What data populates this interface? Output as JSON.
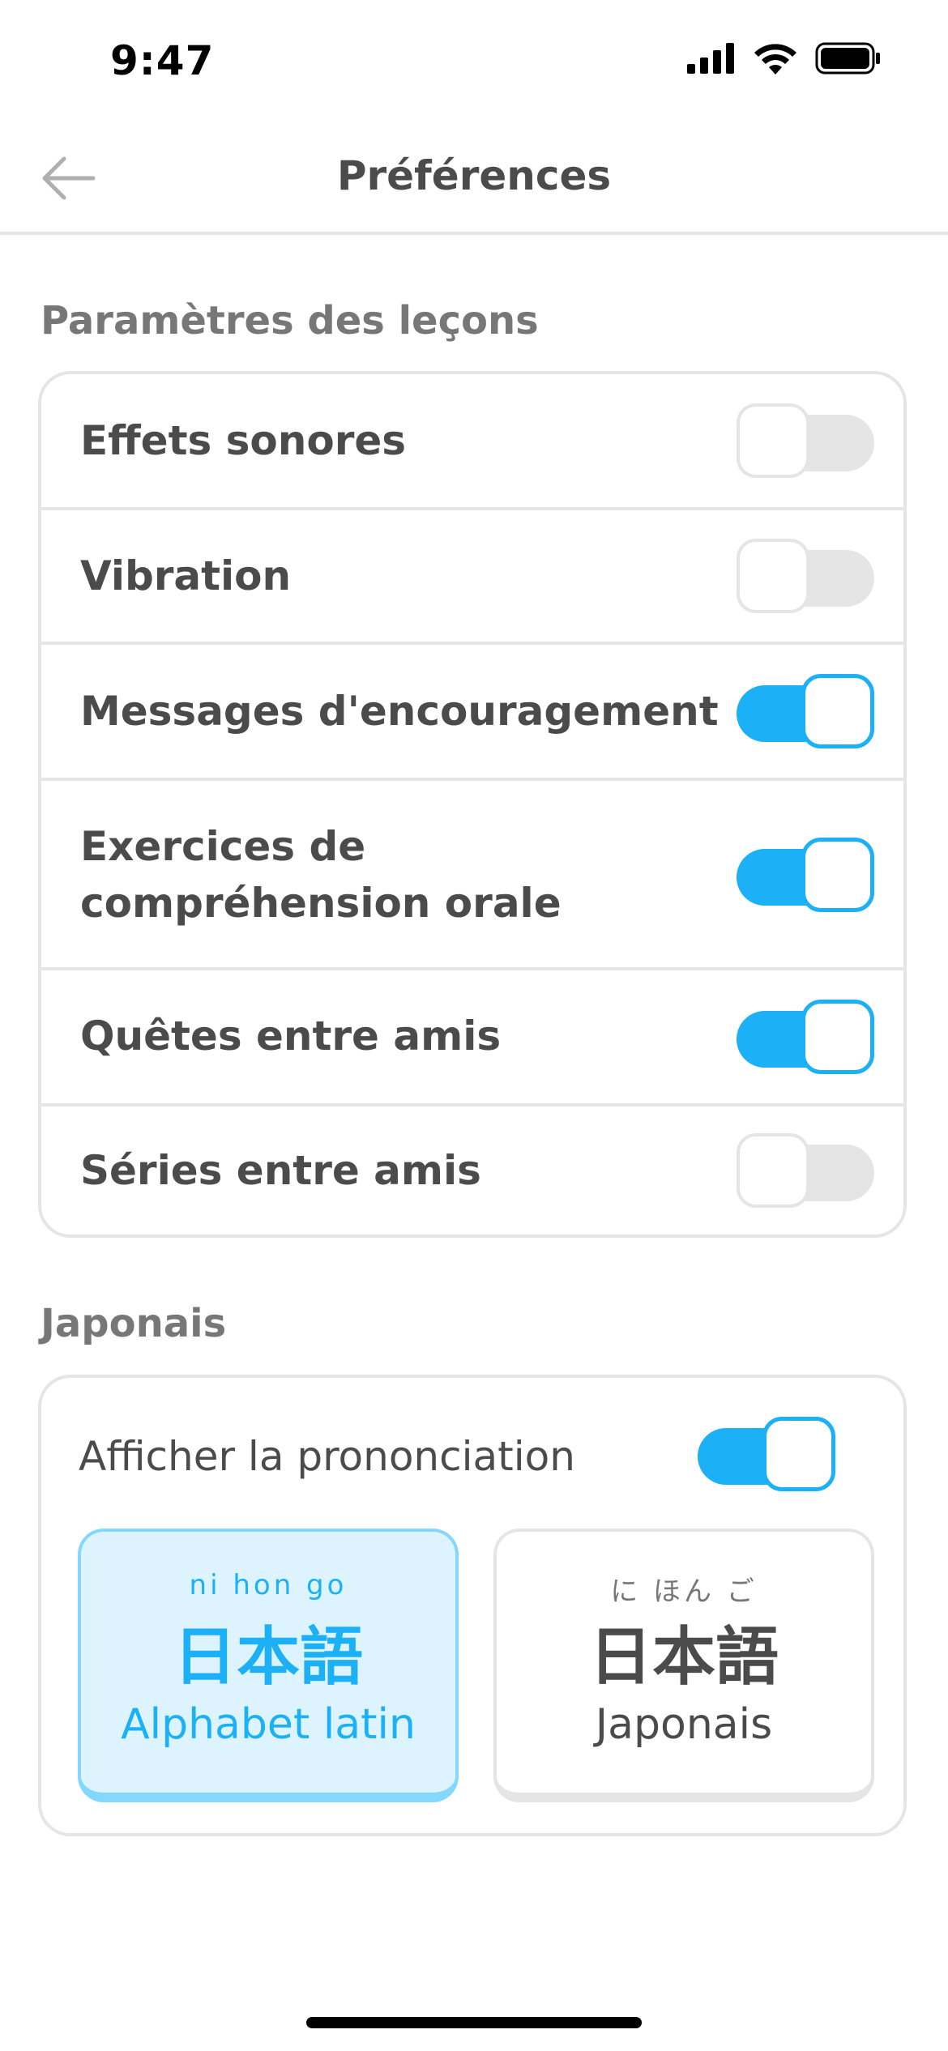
{
  "status_bar": {
    "time": "9:47"
  },
  "header": {
    "title": "Préférences"
  },
  "lesson_settings": {
    "title": "Paramètres des leçons",
    "items": [
      {
        "label": "Effets sonores",
        "enabled": false
      },
      {
        "label": "Vibration",
        "enabled": false
      },
      {
        "label": "Messages d'encouragement",
        "enabled": true
      },
      {
        "label_line1": "Exercices de",
        "label_line2": "compréhension orale",
        "enabled": true
      },
      {
        "label": "Quêtes entre amis",
        "enabled": true
      },
      {
        "label": "Séries entre amis",
        "enabled": false
      }
    ]
  },
  "japanese": {
    "title": "Japonais",
    "show_pronunciation_label": "Afficher la prononciation",
    "show_pronunciation_enabled": true,
    "options": [
      {
        "furigana": "ni hon go",
        "kanji": "日本語",
        "label": "Alphabet latin",
        "selected": true
      },
      {
        "furigana": "に ほん ご",
        "kanji": "日本語",
        "label": "Japonais",
        "selected": false
      }
    ]
  },
  "colors": {
    "accent": "#1cb0f6",
    "accent_light": "#ddf4ff",
    "border": "#e5e5e5",
    "text": "#4b4b4b",
    "muted": "#777777"
  }
}
